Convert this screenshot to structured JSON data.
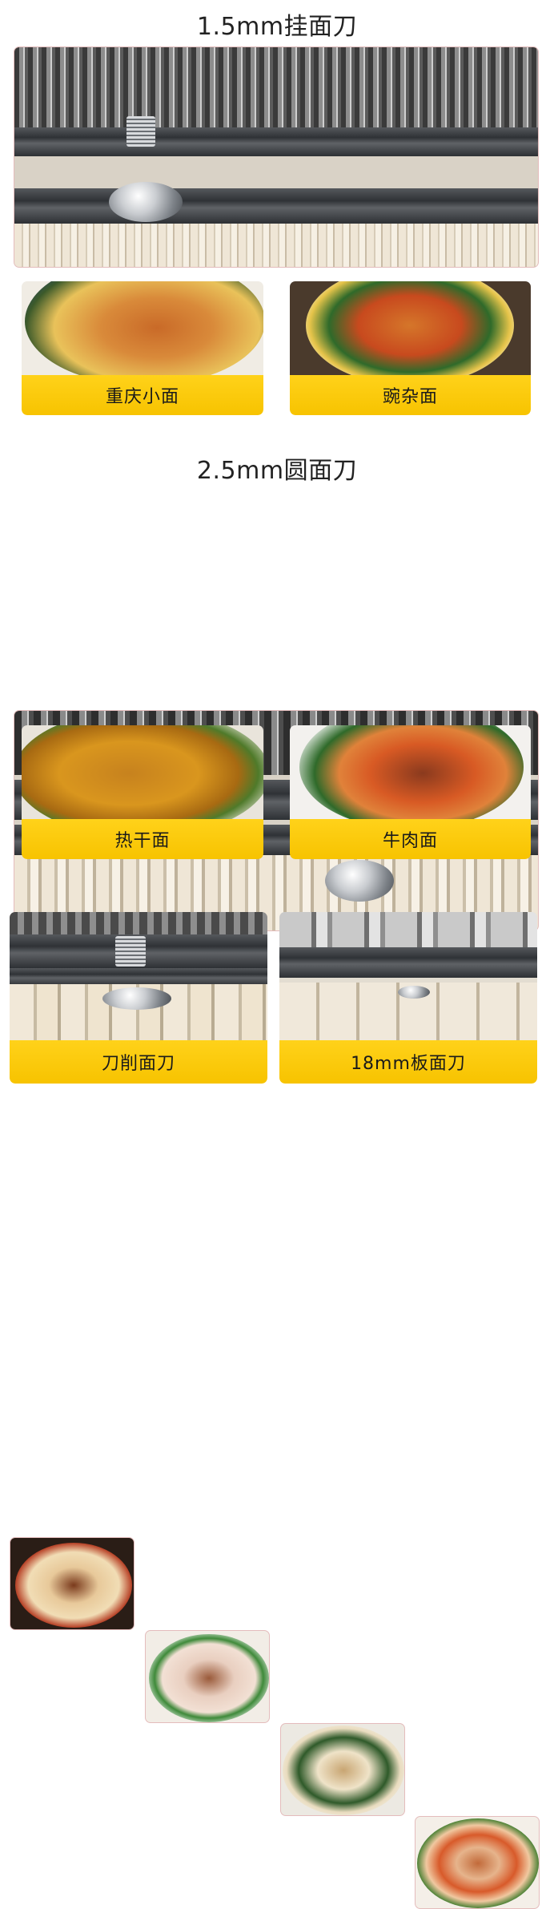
{
  "sections": [
    {
      "title": "1.5mm挂面刀",
      "dishes": [
        "重庆小面",
        "豌杂面"
      ]
    },
    {
      "title": "2.5mm圆面刀",
      "dishes": [
        "热干面",
        "牛肉面"
      ]
    }
  ],
  "bottom": {
    "blades": [
      "刀削面刀",
      "18mm板面刀"
    ]
  },
  "colors": {
    "label_yellow": "#f7c300",
    "border_pink": "#e4bcbc"
  }
}
